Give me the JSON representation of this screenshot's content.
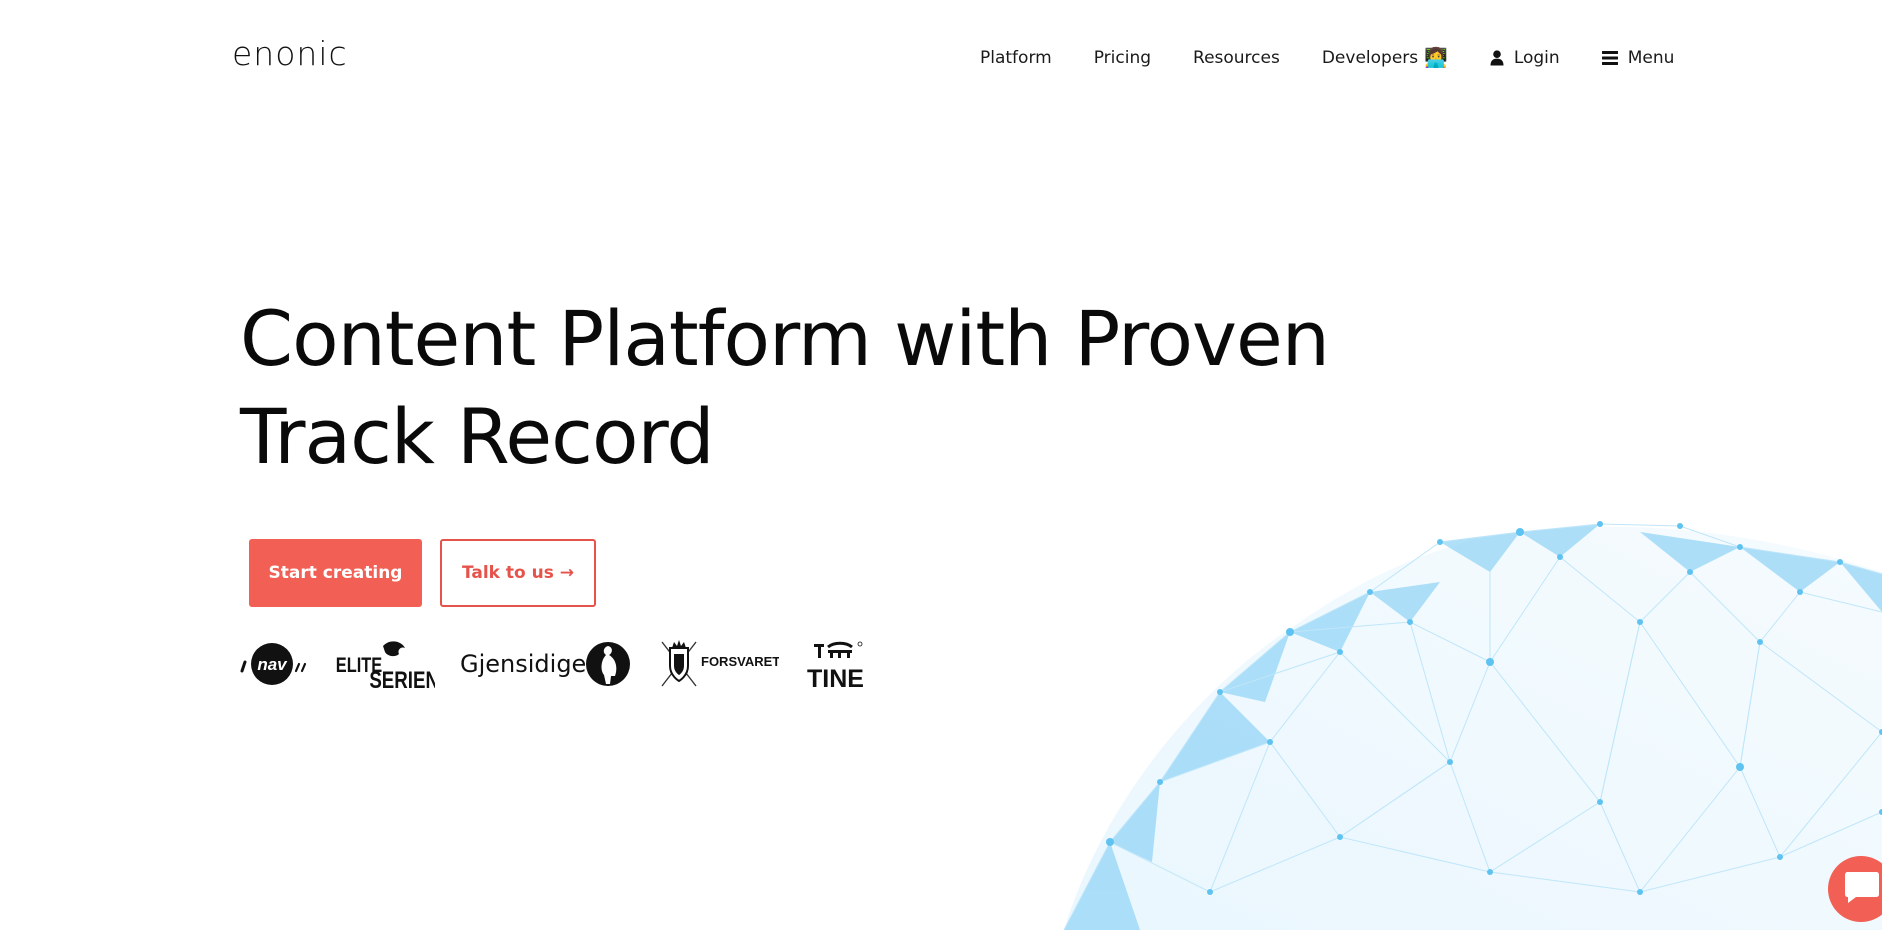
{
  "header": {
    "logo_text": "enonic",
    "nav": {
      "platform": "Platform",
      "pricing": "Pricing",
      "resources": "Resources",
      "developers": "Developers",
      "developers_emoji": "👩‍💻",
      "login": "Login",
      "menu": "Menu"
    }
  },
  "hero": {
    "title_line1": "Content Platform with Proven",
    "title_line2": "Track Record",
    "primary_cta": "Start creating",
    "secondary_cta": "Talk to us →"
  },
  "client_logos": {
    "nav": "nav",
    "eliteserien_top": "ELITE",
    "eliteserien_bottom": "SERIEN",
    "gjensidige": "Gjensidige",
    "forsvaret": "FORSVARET",
    "tine": "TINE"
  },
  "colors": {
    "accent": "#f25f55",
    "accent_text": "#e5534b",
    "globe_blue": "#7fd0f5"
  },
  "icons": {
    "login": "user-icon",
    "menu": "hamburger-menu-icon",
    "chat": "chat-icon"
  }
}
